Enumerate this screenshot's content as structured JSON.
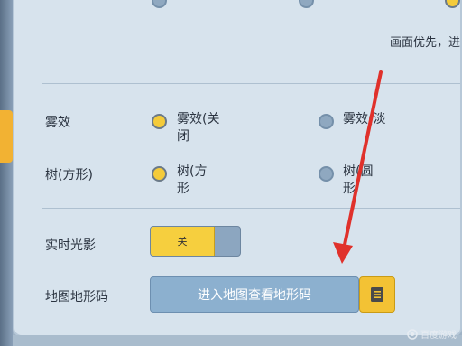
{
  "hint_text": "画面优先，进",
  "settings": {
    "fog": {
      "label": "雾效",
      "options": [
        {
          "text": "雾效(关\n闭",
          "selected": true
        },
        {
          "text": "雾效(淡",
          "selected": false
        }
      ]
    },
    "tree": {
      "label": "树(方形)",
      "options": [
        {
          "text": "树(方\n形",
          "selected": true
        },
        {
          "text": "树(圆\n形",
          "selected": false
        }
      ]
    },
    "realtime_shadow": {
      "label": "实时光影",
      "toggle_text": "关",
      "enabled": false
    },
    "map_code": {
      "label": "地图地形码",
      "button_text": "进入地图查看地形码"
    }
  },
  "watermark": "百度游戏",
  "annotation": {
    "type": "arrow",
    "color": "#e0312b"
  },
  "colors": {
    "accent_yellow": "#f4cb3a",
    "panel_bg": "#d7e3ed"
  }
}
